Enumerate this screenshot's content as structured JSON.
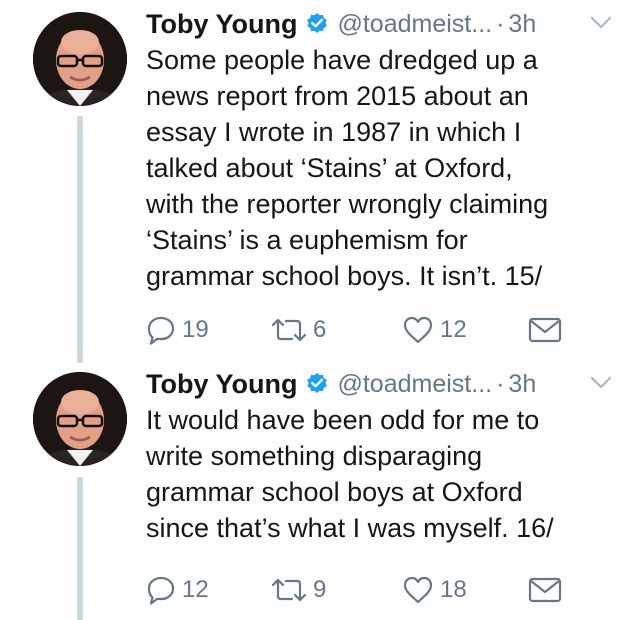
{
  "tweets": [
    {
      "author_name": "Toby Young",
      "handle": "@toadmeist...",
      "separator": "·",
      "time": "3h",
      "text_lines": [
        "Some people have dredged up a",
        "news report from 2015 about an",
        "essay I wrote in 1987 in which I",
        "talked about ‘Stains’ at Oxford,",
        "with the reporter wrongly claiming",
        "‘Stains’ is a euphemism for",
        "grammar school boys. It isn’t. 15/"
      ],
      "replies": "19",
      "retweets": "6",
      "likes": "12"
    },
    {
      "author_name": "Toby Young",
      "handle": "@toadmeist...",
      "separator": "·",
      "time": "3h",
      "text_lines": [
        "It would have been odd for me to",
        "write something disparaging",
        "grammar school boys at Oxford",
        "since that’s what I was myself. 16/"
      ],
      "replies": "12",
      "retweets": "9",
      "likes": "18"
    }
  ],
  "icons": {
    "verified": "verified-badge-icon",
    "caret": "chevron-down-icon",
    "reply": "reply-icon",
    "retweet": "retweet-icon",
    "like": "heart-icon",
    "message": "envelope-icon"
  },
  "colors": {
    "verified_blue": "#1da1f2",
    "text_primary": "#14171a",
    "text_secondary": "#657786",
    "thread_line": "#ccd6dd"
  }
}
